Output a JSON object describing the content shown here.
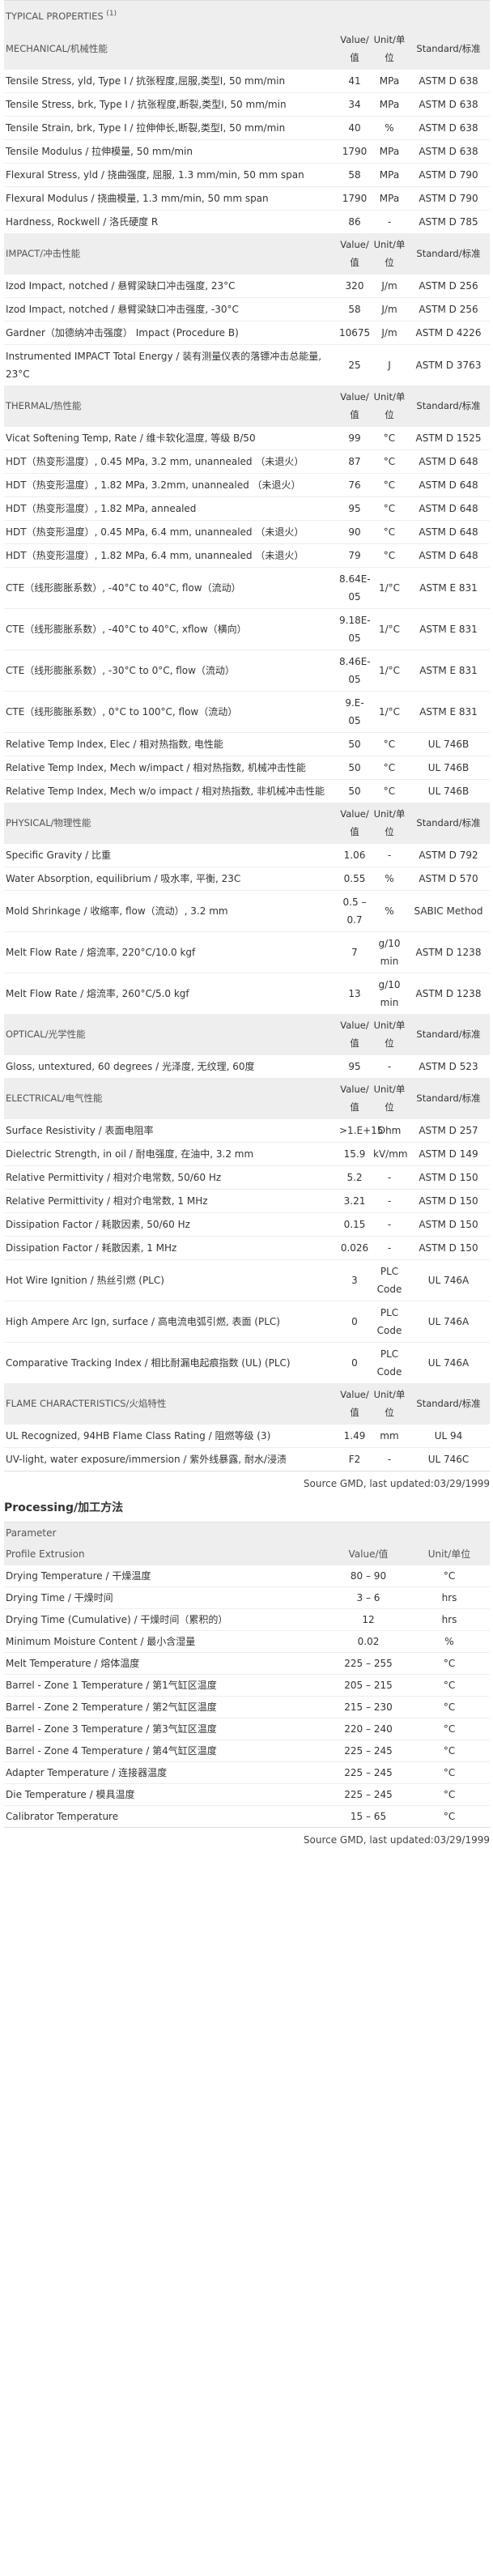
{
  "typical": {
    "title": "TYPICAL PROPERTIES",
    "note": "(1)",
    "sections": [
      {
        "name": "MECHANICAL/机械性能",
        "value_col": "Value/值",
        "unit_col": "Unit/单位",
        "std_col": "Standard/标准",
        "rows": [
          {
            "label": "Tensile Stress, yld, Type I / 抗张程度,屈服,类型I, 50 mm/min",
            "value": "41",
            "unit": "MPa",
            "std": "ASTM D 638"
          },
          {
            "label": "Tensile Stress, brk, Type I / 抗张程度,断裂,类型I, 50 mm/min",
            "value": "34",
            "unit": "MPa",
            "std": "ASTM D 638"
          },
          {
            "label": "Tensile Strain, brk, Type I / 拉伸伸长,断裂,类型I, 50 mm/min",
            "value": "40",
            "unit": "%",
            "std": "ASTM D 638"
          },
          {
            "label": "Tensile Modulus / 拉伸模量, 50 mm/min",
            "value": "1790",
            "unit": "MPa",
            "std": "ASTM D 638"
          },
          {
            "label": "Flexural Stress, yld / 挠曲强度, 屈服, 1.3 mm/min, 50 mm span",
            "value": "58",
            "unit": "MPa",
            "std": "ASTM D 790"
          },
          {
            "label": "Flexural Modulus / 挠曲模量, 1.3 mm/min, 50 mm span",
            "value": "1790",
            "unit": "MPa",
            "std": "ASTM D 790"
          },
          {
            "label": "Hardness, Rockwell / 洛氏硬度 R",
            "value": "86",
            "unit": "-",
            "std": "ASTM D 785"
          }
        ]
      },
      {
        "name": "IMPACT/冲击性能",
        "value_col": "Value/值",
        "unit_col": "Unit/单位",
        "std_col": "Standard/标准",
        "rows": [
          {
            "label": "Izod Impact, notched / 悬臂梁缺口冲击强度, 23°C",
            "value": "320",
            "unit": "J/m",
            "std": "ASTM D 256"
          },
          {
            "label": "Izod Impact, notched / 悬臂梁缺口冲击强度, -30°C",
            "value": "58",
            "unit": "J/m",
            "std": "ASTM D 256"
          },
          {
            "label": "Gardner（加德纳冲击强度） Impact (Procedure B)",
            "value": "10675",
            "unit": "J/m",
            "std": "ASTM D 4226"
          },
          {
            "label": "Instrumented IMPACT Total Energy / 装有测量仪表的落镖冲击总能量, 23°C",
            "value": "25",
            "unit": "J",
            "std": "ASTM D 3763"
          }
        ]
      },
      {
        "name": "THERMAL/热性能",
        "value_col": "Value/值",
        "unit_col": "Unit/单位",
        "std_col": "Standard/标准",
        "rows": [
          {
            "label": "Vicat Softening Temp, Rate / 维卡软化温度, 等级 B/50",
            "value": "99",
            "unit": "°C",
            "std": "ASTM D 1525"
          },
          {
            "label": "HDT（热变形温度）, 0.45 MPa, 3.2 mm, unannealed （未退火）",
            "value": "87",
            "unit": "°C",
            "std": "ASTM D 648"
          },
          {
            "label": "HDT（热变形温度）, 1.82 MPa, 3.2mm, unannealed （未退火）",
            "value": "76",
            "unit": "°C",
            "std": "ASTM D 648"
          },
          {
            "label": "HDT（热变形温度）, 1.82 MPa, annealed",
            "value": "95",
            "unit": "°C",
            "std": "ASTM D 648"
          },
          {
            "label": "HDT（热变形温度）, 0.45 MPa, 6.4 mm, unannealed （未退火）",
            "value": "90",
            "unit": "°C",
            "std": "ASTM D 648"
          },
          {
            "label": "HDT（热变形温度）, 1.82 MPa, 6.4 mm, unannealed （未退火）",
            "value": "79",
            "unit": "°C",
            "std": "ASTM D 648"
          },
          {
            "label": "CTE（线形膨胀系数）, -40°C to 40°C, flow（流动）",
            "value": "8.64E-05",
            "unit": "1/°C",
            "std": "ASTM E 831"
          },
          {
            "label": "CTE（线形膨胀系数）, -40°C to 40°C, xflow（横向）",
            "value": "9.18E-05",
            "unit": "1/°C",
            "std": "ASTM E 831"
          },
          {
            "label": "CTE（线形膨胀系数）, -30°C to 0°C, flow（流动）",
            "value": "8.46E-05",
            "unit": "1/°C",
            "std": "ASTM E 831"
          },
          {
            "label": "CTE（线形膨胀系数）, 0°C to 100°C, flow（流动）",
            "value": "9.E-05",
            "unit": "1/°C",
            "std": "ASTM E 831"
          },
          {
            "label": "Relative Temp Index, Elec / 相对热指数, 电性能",
            "value": "50",
            "unit": "°C",
            "std": "UL 746B"
          },
          {
            "label": "Relative Temp Index, Mech w/impact / 相对热指数, 机械冲击性能",
            "value": "50",
            "unit": "°C",
            "std": "UL 746B"
          },
          {
            "label": "Relative Temp Index, Mech w/o impact / 相对热指数, 非机械冲击性能",
            "value": "50",
            "unit": "°C",
            "std": "UL 746B"
          }
        ]
      },
      {
        "name": "PHYSICAL/物理性能",
        "value_col": "Value/值",
        "unit_col": "Unit/单位",
        "std_col": "Standard/标准",
        "rows": [
          {
            "label": "Specific Gravity / 比重",
            "value": "1.06",
            "unit": "-",
            "std": "ASTM D 792"
          },
          {
            "label": "Water Absorption, equilibrium / 吸水率, 平衡, 23C",
            "value": "0.55",
            "unit": "%",
            "std": "ASTM D 570"
          },
          {
            "label": "Mold Shrinkage / 收缩率, flow（流动）, 3.2 mm",
            "value": "0.5 – 0.7",
            "unit": "%",
            "std": "SABIC Method"
          },
          {
            "label": "Melt Flow Rate / 熔流率, 220°C/10.0 kgf",
            "value": "7",
            "unit": "g/10 min",
            "std": "ASTM D 1238"
          },
          {
            "label": "Melt Flow Rate / 熔流率, 260°C/5.0 kgf",
            "value": "13",
            "unit": "g/10 min",
            "std": "ASTM D 1238"
          }
        ]
      },
      {
        "name": "OPTICAL/光学性能",
        "value_col": "Value/值",
        "unit_col": "Unit/单位",
        "std_col": "Standard/标准",
        "rows": [
          {
            "label": "Gloss, untextured, 60 degrees / 光泽度, 无纹理, 60度",
            "value": "95",
            "unit": "-",
            "std": "ASTM D 523"
          }
        ]
      },
      {
        "name": "ELECTRICAL/电气性能",
        "value_col": "Value/值",
        "unit_col": "Unit/单位",
        "std_col": "Standard/标准",
        "rows": [
          {
            "label": "Surface Resistivity / 表面电阻率",
            "value": ">1.E+15",
            "unit": "Ohm",
            "std": "ASTM D 257"
          },
          {
            "label": "Dielectric Strength, in oil / 耐电强度, 在油中, 3.2 mm",
            "value": "15.9",
            "unit": "kV/mm",
            "std": "ASTM D 149"
          },
          {
            "label": "Relative Permittivity / 相对介电常数, 50/60 Hz",
            "value": "5.2",
            "unit": "-",
            "std": "ASTM D 150"
          },
          {
            "label": "Relative Permittivity / 相对介电常数, 1 MHz",
            "value": "3.21",
            "unit": "-",
            "std": "ASTM D 150"
          },
          {
            "label": "Dissipation Factor / 耗散因素, 50/60 Hz",
            "value": "0.15",
            "unit": "-",
            "std": "ASTM D 150"
          },
          {
            "label": "Dissipation Factor / 耗散因素, 1 MHz",
            "value": "0.026",
            "unit": "-",
            "std": "ASTM D 150"
          },
          {
            "label": "Hot Wire Ignition / 热丝引燃 (PLC)",
            "value": "3",
            "unit": "PLC Code",
            "std": "UL 746A"
          },
          {
            "label": "High Ampere Arc Ign, surface / 高电流电弧引燃, 表面 (PLC)",
            "value": "0",
            "unit": "PLC Code",
            "std": "UL 746A"
          },
          {
            "label": "Comparative Tracking Index / 相比耐漏电起痕指数 (UL) (PLC)",
            "value": "0",
            "unit": "PLC Code",
            "std": "UL 746A"
          }
        ]
      },
      {
        "name": "FLAME CHARACTERISTICS/火焰特性",
        "value_col": "Value/值",
        "unit_col": "Unit/单位",
        "std_col": "Standard/标准",
        "rows": [
          {
            "label": "UL Recognized, 94HB Flame Class Rating / 阻燃等级 (3)",
            "value": "1.49",
            "unit": "mm",
            "std": "UL 94"
          },
          {
            "label": "UV-light, water exposure/immersion / 紫外线暴露, 耐水/浸渍",
            "value": "F2",
            "unit": "-",
            "std": "UL 746C"
          }
        ]
      }
    ],
    "source": "Source GMD, last updated:03/29/1999"
  },
  "processing": {
    "title": "Processing/加工方法",
    "param_label": "Parameter",
    "sub_label": "Profile Extrusion",
    "value_col": "Value/值",
    "unit_col": "Unit/单位",
    "rows": [
      {
        "label": "Drying Temperature / 干燥温度",
        "value": "80 – 90",
        "unit": "°C"
      },
      {
        "label": "Drying Time / 干燥时间",
        "value": "3 – 6",
        "unit": "hrs"
      },
      {
        "label": "Drying Time (Cumulative) / 干燥时间（累积的）",
        "value": "12",
        "unit": "hrs"
      },
      {
        "label": "Minimum Moisture Content / 最小含湿量",
        "value": "0.02",
        "unit": "%"
      },
      {
        "label": "Melt Temperature / 熔体温度",
        "value": "225 – 255",
        "unit": "°C"
      },
      {
        "label": "Barrel - Zone 1 Temperature / 第1气缸区温度",
        "value": "205 – 215",
        "unit": "°C"
      },
      {
        "label": "Barrel - Zone 2 Temperature / 第2气缸区温度",
        "value": "215 – 230",
        "unit": "°C"
      },
      {
        "label": "Barrel - Zone 3 Temperature / 第3气缸区温度",
        "value": "220 – 240",
        "unit": "°C"
      },
      {
        "label": "Barrel - Zone 4 Temperature / 第4气缸区温度",
        "value": "225 – 245",
        "unit": "°C"
      },
      {
        "label": "Adapter Temperature / 连接器温度",
        "value": "225 – 245",
        "unit": "°C"
      },
      {
        "label": "Die Temperature / 模具温度",
        "value": "225 – 245",
        "unit": "°C"
      },
      {
        "label": "Calibrator Temperature",
        "value": "15 – 65",
        "unit": "°C"
      }
    ],
    "source": "Source GMD, last updated:03/29/1999"
  }
}
